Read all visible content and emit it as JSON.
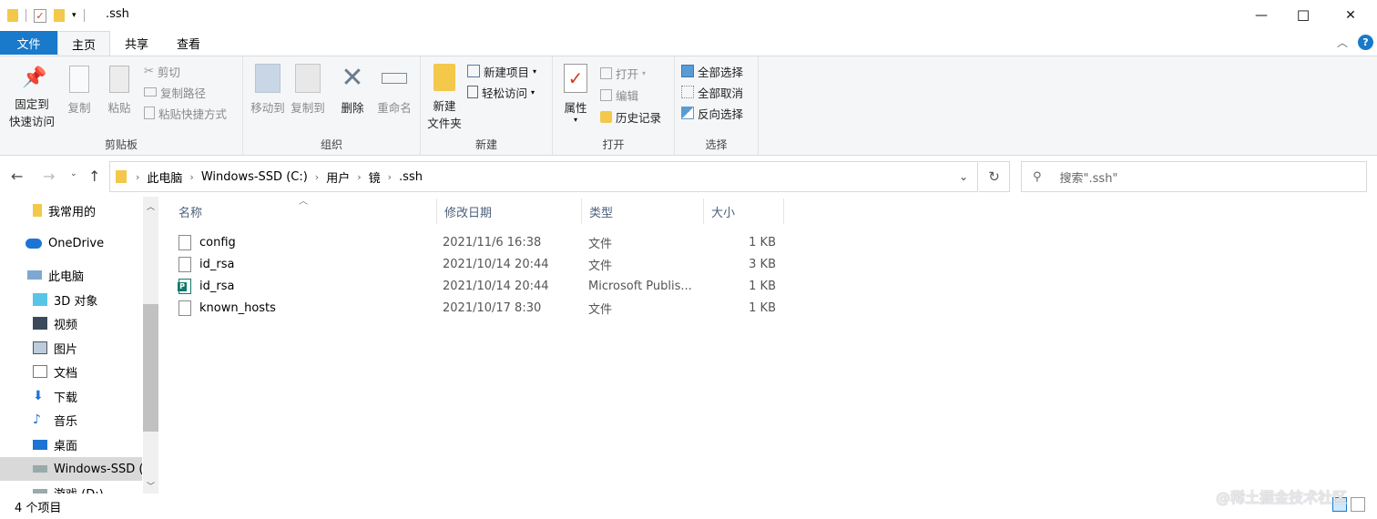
{
  "window": {
    "title": ".ssh",
    "minimize": "—",
    "maximize": "☐",
    "close": "✕"
  },
  "tabs": {
    "file": "文件",
    "home": "主页",
    "share": "共享",
    "view": "查看"
  },
  "ribbon": {
    "clipboard": {
      "group": "剪贴板",
      "pin_line1": "固定到",
      "pin_line2": "快速访问",
      "copy": "复制",
      "paste": "粘贴",
      "cut": "剪切",
      "copy_path": "复制路径",
      "paste_shortcut": "粘贴快捷方式"
    },
    "organize": {
      "group": "组织",
      "move_to": "移动到",
      "copy_to": "复制到",
      "delete": "删除",
      "rename": "重命名"
    },
    "new": {
      "group": "新建",
      "new_folder_line1": "新建",
      "new_folder_line2": "文件夹",
      "new_item": "新建项目",
      "easy_access": "轻松访问"
    },
    "open": {
      "group": "打开",
      "properties": "属性",
      "open": "打开",
      "edit": "编辑",
      "history": "历史记录"
    },
    "select": {
      "group": "选择",
      "select_all": "全部选择",
      "select_none": "全部取消",
      "invert": "反向选择"
    }
  },
  "address": {
    "breadcrumbs": [
      "此电脑",
      "Windows-SSD (C:)",
      "用户",
      "镜",
      ".ssh"
    ],
    "search_placeholder": "搜索\".ssh\""
  },
  "nav": {
    "items": [
      {
        "label": "我常用的",
        "icon": "folder-icon"
      },
      {
        "label": "OneDrive",
        "icon": "cloud-icon"
      },
      {
        "label": "此电脑",
        "icon": "computer-icon"
      },
      {
        "label": "3D 对象",
        "icon": "3d-objects-icon"
      },
      {
        "label": "视频",
        "icon": "video-icon"
      },
      {
        "label": "图片",
        "icon": "pictures-icon"
      },
      {
        "label": "文档",
        "icon": "documents-icon"
      },
      {
        "label": "下载",
        "icon": "download-icon"
      },
      {
        "label": "音乐",
        "icon": "music-icon"
      },
      {
        "label": "桌面",
        "icon": "desktop-icon"
      },
      {
        "label": "Windows-SSD (",
        "icon": "drive-icon"
      },
      {
        "label": "游戏 (D:)",
        "icon": "drive-icon"
      }
    ]
  },
  "columns": {
    "name": "名称",
    "date": "修改日期",
    "type": "类型",
    "size": "大小"
  },
  "files": [
    {
      "name": "config",
      "date": "2021/11/6 16:38",
      "type": "文件",
      "size": "1 KB"
    },
    {
      "name": "id_rsa",
      "date": "2021/10/14 20:44",
      "type": "文件",
      "size": "3 KB"
    },
    {
      "name": "id_rsa",
      "date": "2021/10/14 20:44",
      "type": "Microsoft Publis...",
      "size": "1 KB"
    },
    {
      "name": "known_hosts",
      "date": "2021/10/17 8:30",
      "type": "文件",
      "size": "1 KB"
    }
  ],
  "status": {
    "count": "4 个项目"
  },
  "watermark": "@稀土掘金技术社区",
  "colors": {
    "accent": "#1979ca",
    "ribbon_bg": "#f5f6f7",
    "header_text": "#4c607a"
  }
}
